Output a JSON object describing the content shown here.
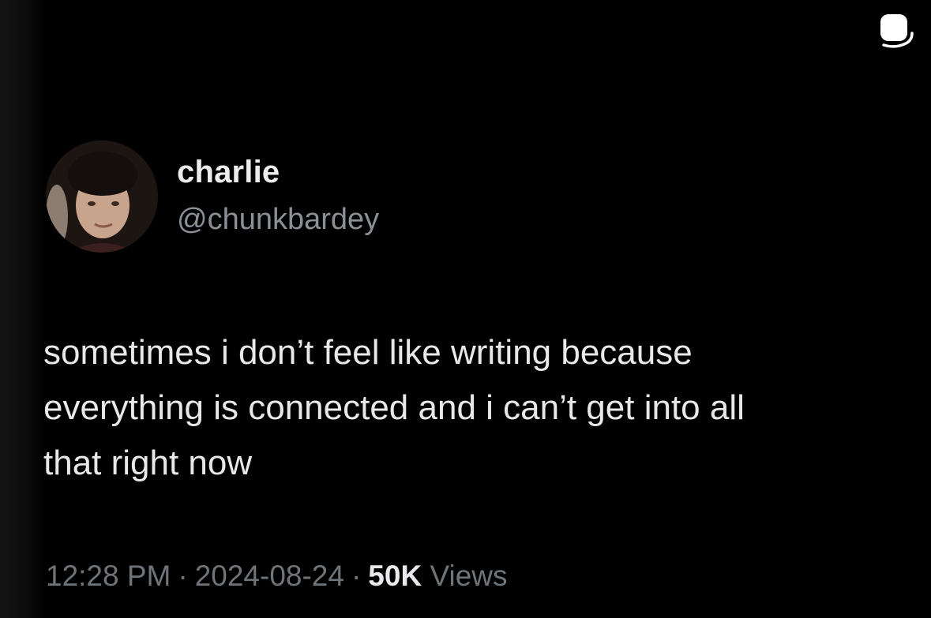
{
  "tweet": {
    "author": {
      "display_name": "charlie",
      "handle": "@chunkbardey"
    },
    "text_lines": [
      "sometimes i don’t feel like writing because",
      "everything is connected and i can’t get into all",
      "that right now"
    ],
    "meta": {
      "time": "12:28 PM",
      "separator": "·",
      "date": "2024-08-24",
      "views_count": "50K",
      "views_label": "Views"
    }
  },
  "icons": {
    "top_right": "sticker-icon",
    "avatar": "avatar"
  },
  "colors": {
    "background": "#000000",
    "text_primary": "#e7e9ea",
    "text_secondary": "#8b9096",
    "meta_text": "#6f7478"
  }
}
